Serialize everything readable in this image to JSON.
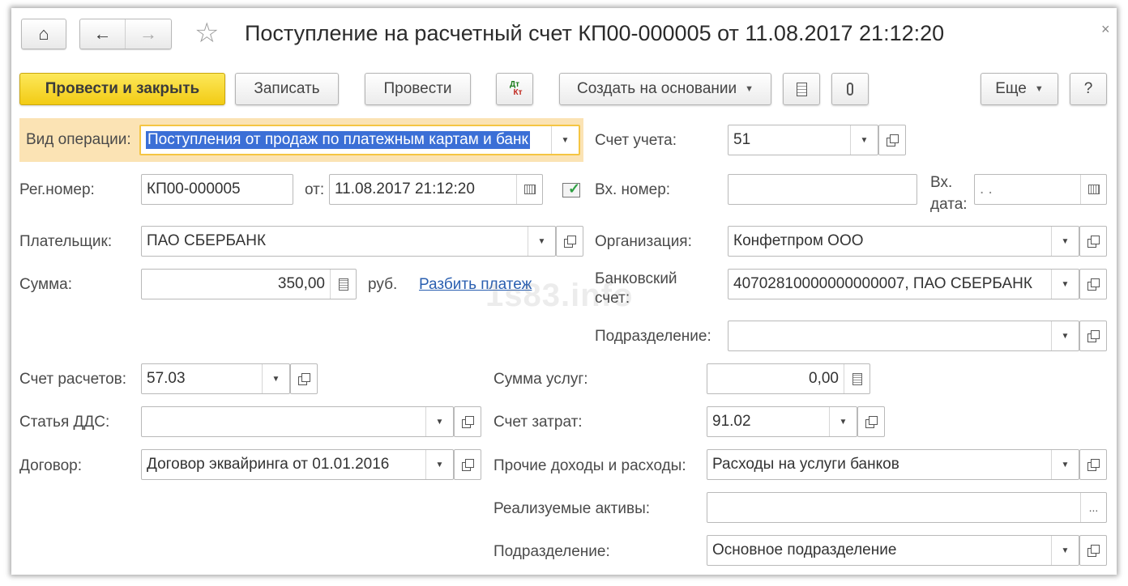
{
  "window": {
    "title": "Поступление на расчетный счет КП00-000005 от 11.08.2017 21:12:20",
    "close_glyph": "×"
  },
  "nav": {
    "home_glyph": "⌂",
    "back_glyph": "←",
    "forward_glyph": "→",
    "star_glyph": "☆"
  },
  "toolbar": {
    "post_close": "Провести и закрыть",
    "save": "Записать",
    "post": "Провести",
    "dt_label": "Дт",
    "kt_label": "Кт",
    "create_based": "Создать на основании",
    "more": "Еще",
    "help": "?"
  },
  "form": {
    "op_type": {
      "label": "Вид операции:",
      "value": "Поступления от продаж по платежным картам и банк"
    },
    "reg_number": {
      "label": "Рег.номер:",
      "value": "КП00-000005"
    },
    "date": {
      "label": "от:",
      "value": "11.08.2017 21:12:20"
    },
    "payer": {
      "label": "Плательщик:",
      "value": "ПАО СБЕРБАНК"
    },
    "amount": {
      "label": "Сумма:",
      "value": "350,00",
      "currency": "руб.",
      "split_link": "Разбить платеж"
    },
    "account": {
      "label": "Счет учета:",
      "value": "51"
    },
    "in_number": {
      "label": "Вх. номер:",
      "value": ""
    },
    "in_date": {
      "label_1": "Вх.",
      "label_2": "дата:",
      "value": " .  . "
    },
    "organization": {
      "label": "Организация:",
      "value": "Конфетпром ООО"
    },
    "bank_account": {
      "label_1": "Банковский",
      "label_2": "счет:",
      "value": "40702810000000000007, ПАО СБЕРБАНК"
    },
    "department_top": {
      "label": "Подразделение:",
      "value": ""
    },
    "settlement_account": {
      "label": "Счет расчетов:",
      "value": "57.03"
    },
    "dds_item": {
      "label": "Статья ДДС:",
      "value": ""
    },
    "contract": {
      "label": "Договор:",
      "value": "Договор эквайринга от 01.01.2016"
    },
    "service_amount": {
      "label": "Сумма услуг:",
      "value": "0,00"
    },
    "expense_account": {
      "label": "Счет затрат:",
      "value": "91.02"
    },
    "other_income": {
      "label": "Прочие доходы и расходы:",
      "value": "Расходы на услуги банков"
    },
    "assets": {
      "label": "Реализуемые активы:",
      "value": ""
    },
    "department_bottom": {
      "label": "Подразделение:",
      "value": "Основное подразделение"
    }
  },
  "watermark": "1s83.info"
}
